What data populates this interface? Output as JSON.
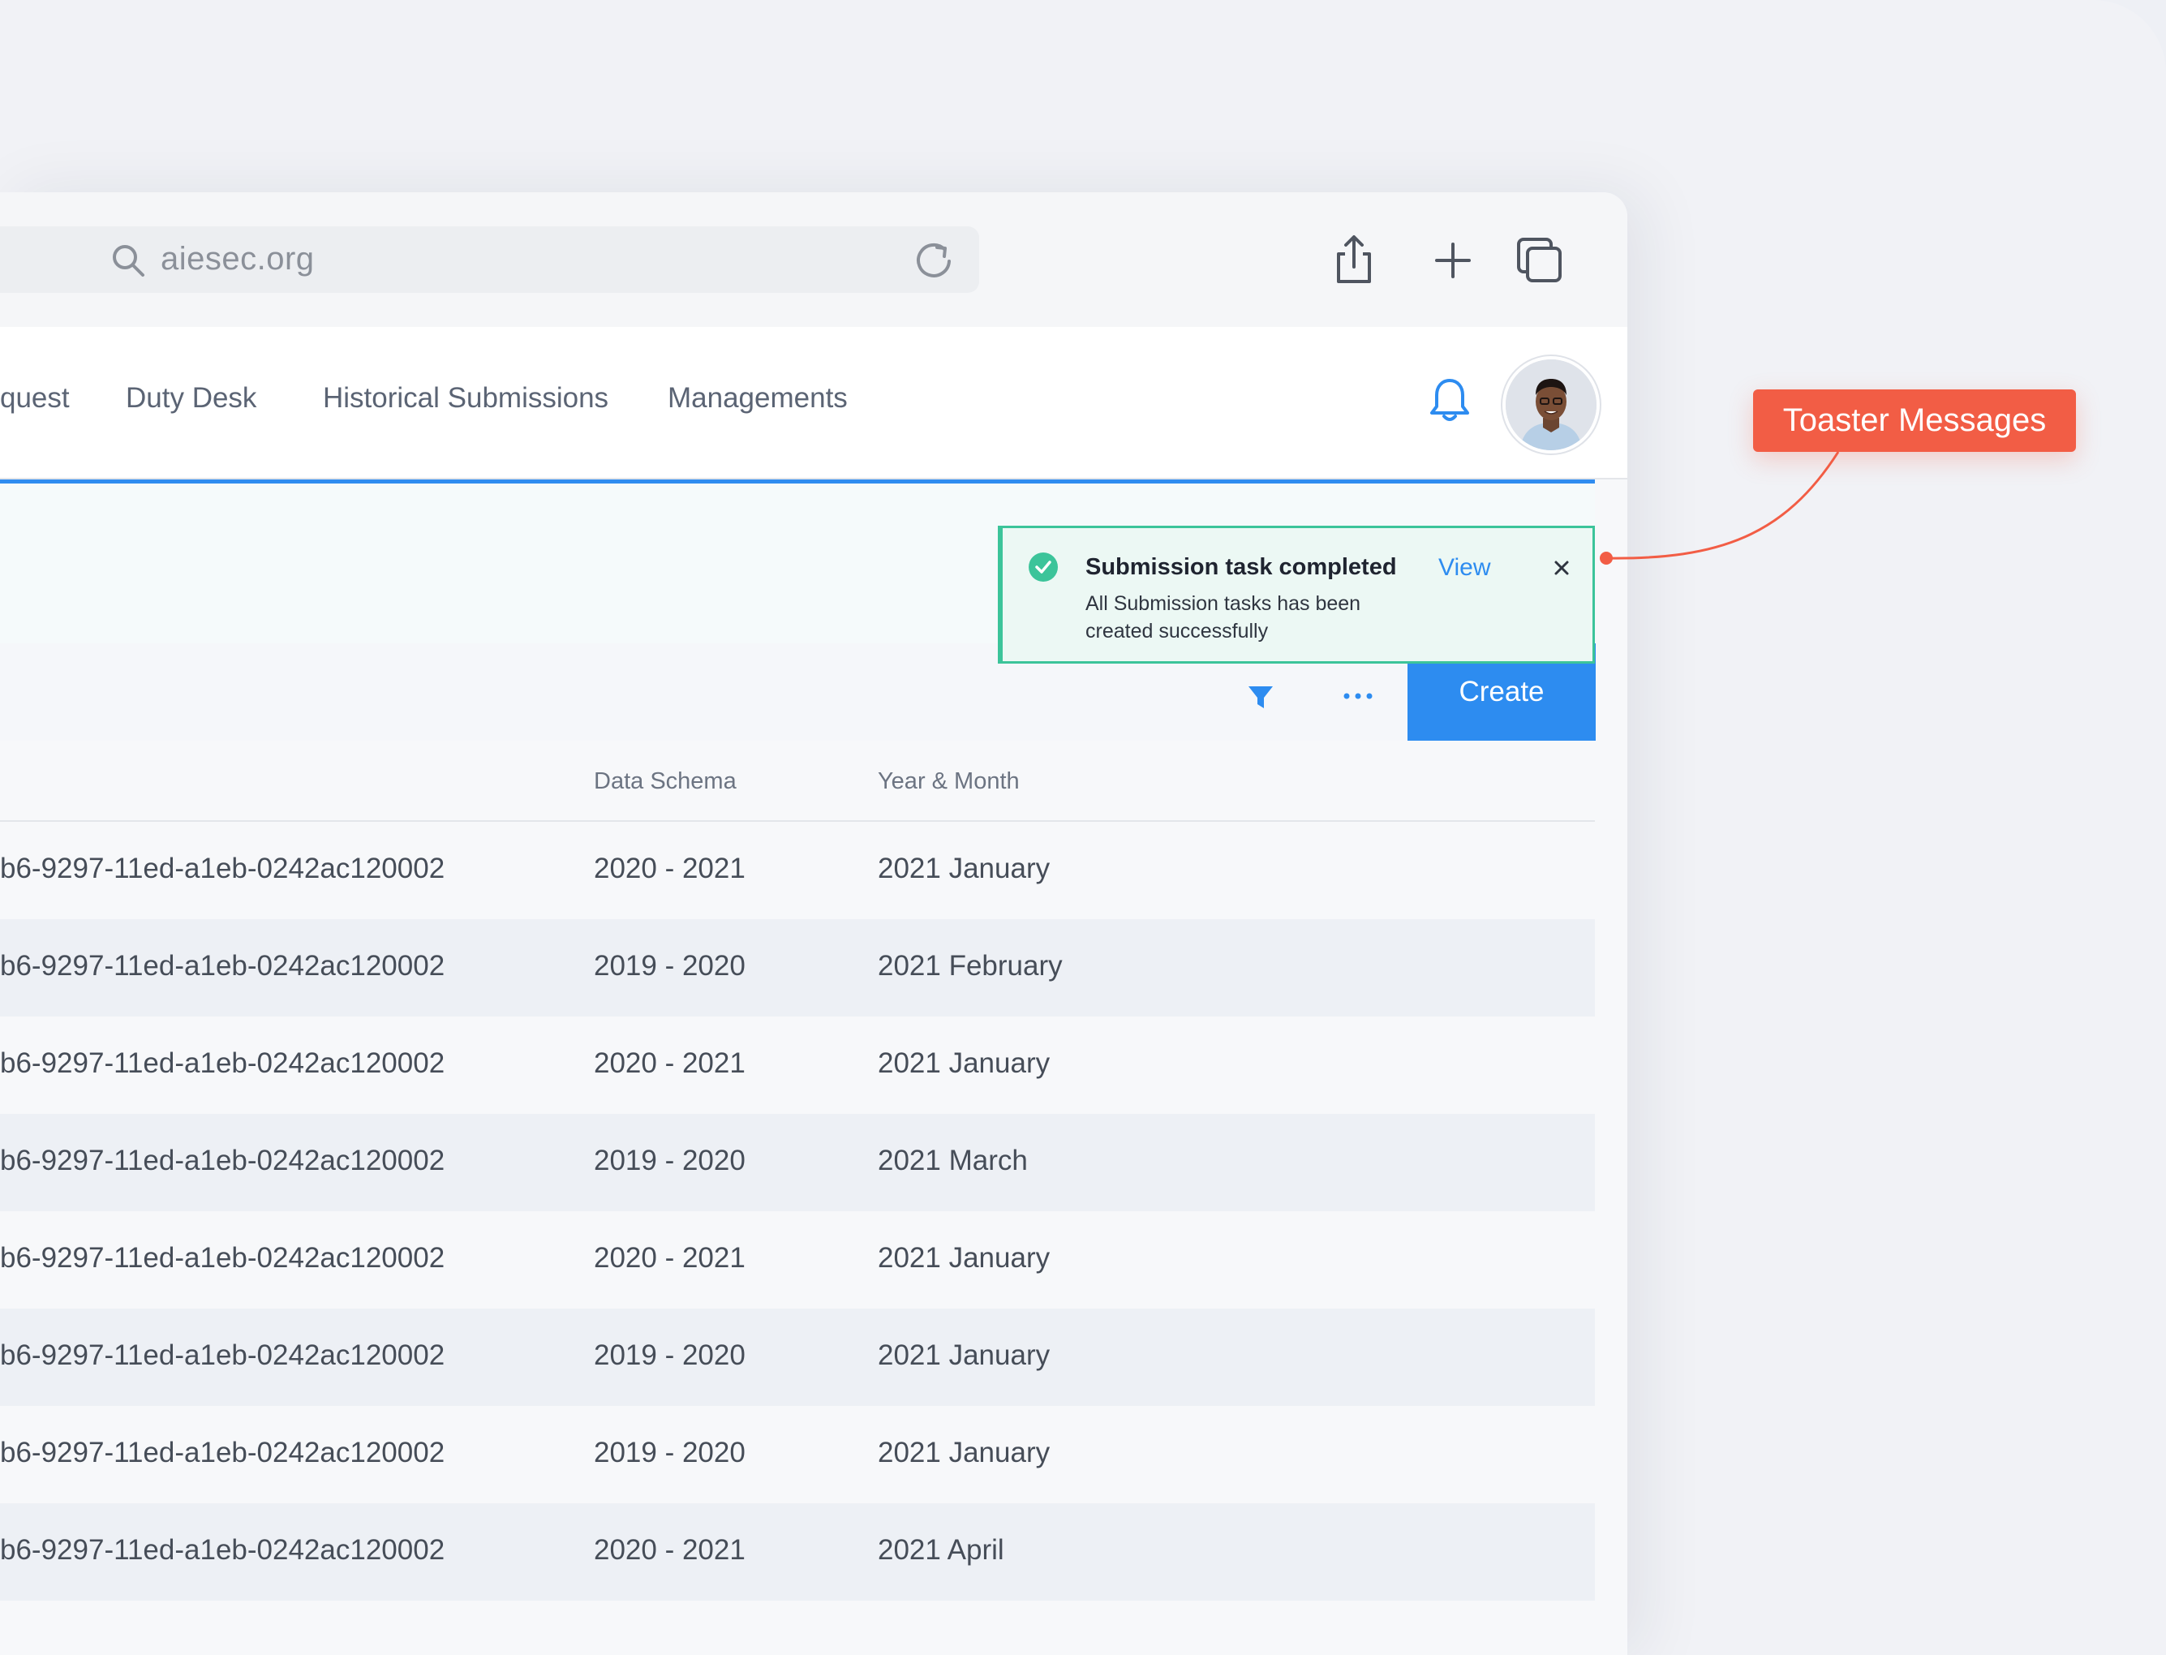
{
  "browser": {
    "url": "aiesec.org"
  },
  "nav": {
    "items": [
      {
        "label": "quest"
      },
      {
        "label": "Duty Desk"
      },
      {
        "label": "Historical Submissions"
      },
      {
        "label": "Managements"
      }
    ]
  },
  "toolbar": {
    "create_label": "Create"
  },
  "table": {
    "headers": [
      "Data Schema",
      "Year & Month"
    ],
    "rows": [
      {
        "id": "b6-9297-11ed-a1eb-0242ac120002",
        "schema": "2020 - 2021",
        "period": "2021 January"
      },
      {
        "id": "b6-9297-11ed-a1eb-0242ac120002",
        "schema": "2019 - 2020",
        "period": "2021 February"
      },
      {
        "id": "b6-9297-11ed-a1eb-0242ac120002",
        "schema": "2020 - 2021",
        "period": "2021 January"
      },
      {
        "id": "b6-9297-11ed-a1eb-0242ac120002",
        "schema": "2019 - 2020",
        "period": "2021 March"
      },
      {
        "id": "b6-9297-11ed-a1eb-0242ac120002",
        "schema": "2020 - 2021",
        "period": "2021 January"
      },
      {
        "id": "b6-9297-11ed-a1eb-0242ac120002",
        "schema": "2019 - 2020",
        "period": "2021 January"
      },
      {
        "id": "b6-9297-11ed-a1eb-0242ac120002",
        "schema": "2019 - 2020",
        "period": "2021 January"
      },
      {
        "id": "b6-9297-11ed-a1eb-0242ac120002",
        "schema": "2020 - 2021",
        "period": "2021 April"
      }
    ]
  },
  "toast": {
    "title": "Submission task completed",
    "message": "All Submission tasks has been created successfully",
    "action_label": "View",
    "status": "success"
  },
  "annotation": {
    "label": "Toaster Messages"
  },
  "icons": {
    "search": "search-icon",
    "reload": "reload-icon",
    "share": "share-icon",
    "new_tab": "plus-icon",
    "tabs": "tabs-icon",
    "bell": "bell-icon",
    "filter": "filter-icon",
    "more": "more-icon",
    "check": "check-circle-icon",
    "close": "close-icon"
  },
  "colors": {
    "accent": "#2d8cf0",
    "success": "#3cc49a",
    "callout": "#f25d45"
  }
}
